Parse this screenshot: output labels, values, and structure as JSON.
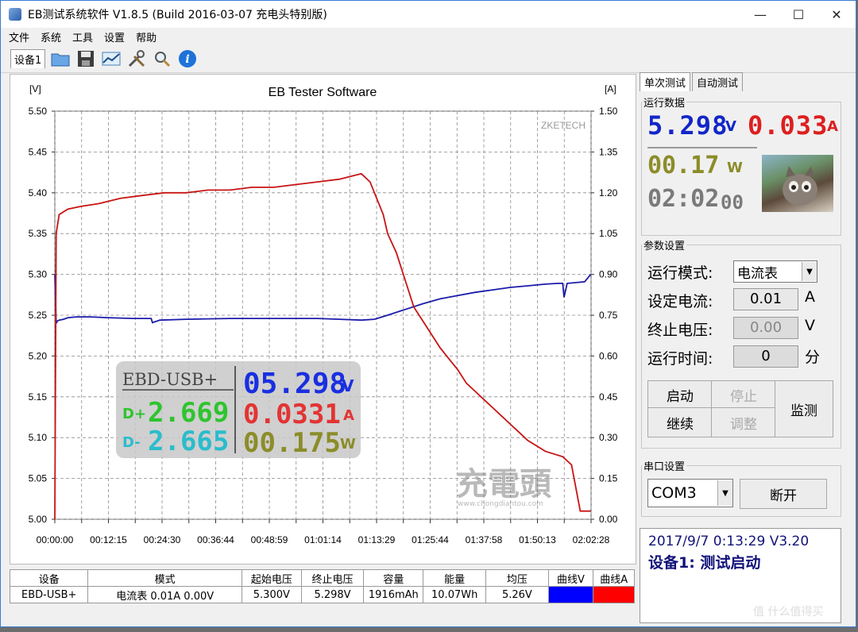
{
  "window": {
    "title": "EB测试系统软件 V1.8.5 (Build 2016-03-07 充电头特别版)",
    "controls": [
      "—",
      "☐",
      "✕"
    ]
  },
  "menu": [
    "文件",
    "系统",
    "工具",
    "设置",
    "帮助"
  ],
  "toolbar": {
    "device_tab": "设备1",
    "icons": [
      "folder-icon",
      "save-icon",
      "chart-icon",
      "tools-icon",
      "search-icon",
      "info-icon"
    ]
  },
  "chart_data": {
    "type": "line",
    "title": "EB Tester Software",
    "watermark_text": "ZKETECH",
    "y_left_unit": "[V]",
    "y_right_unit": "[A]",
    "y_left_ticks": [
      "5.50",
      "5.45",
      "5.40",
      "5.35",
      "5.30",
      "5.25",
      "5.20",
      "5.15",
      "5.10",
      "5.05",
      "5.00"
    ],
    "y_right_ticks": [
      "1.50",
      "1.35",
      "1.20",
      "1.05",
      "0.90",
      "0.75",
      "0.60",
      "0.45",
      "0.30",
      "0.15",
      "0.00"
    ],
    "x_ticks": [
      "00:00:00",
      "00:12:15",
      "00:24:30",
      "00:36:44",
      "00:48:59",
      "01:01:14",
      "01:13:29",
      "01:25:44",
      "01:37:58",
      "01:50:13",
      "02:02:28"
    ],
    "ylim_left": [
      5.0,
      5.5
    ],
    "ylim_right": [
      0.0,
      1.5
    ],
    "x_range_minutes": [
      0,
      122.47
    ],
    "grid": true,
    "series": [
      {
        "color": "#1b1baa",
        "axis": "left",
        "x_minutes": [
          0,
          0.3,
          0.6,
          1,
          2,
          3,
          5,
          8,
          12,
          18,
          22,
          22.3,
          24,
          30,
          40,
          50,
          60,
          65,
          70,
          73,
          76,
          80,
          84,
          88,
          92,
          96,
          100,
          104,
          108,
          112,
          115,
          116,
          116.3,
          117,
          121,
          122.4
        ],
        "y": [
          5.3,
          5.24,
          5.243,
          5.244,
          5.245,
          5.247,
          5.248,
          5.248,
          5.247,
          5.246,
          5.246,
          5.241,
          5.244,
          5.245,
          5.246,
          5.246,
          5.246,
          5.245,
          5.244,
          5.245,
          5.25,
          5.257,
          5.264,
          5.27,
          5.274,
          5.278,
          5.281,
          5.284,
          5.286,
          5.288,
          5.289,
          5.289,
          5.272,
          5.289,
          5.291,
          5.3
        ]
      },
      {
        "color": "#c81414",
        "axis": "right",
        "x_minutes": [
          0,
          0.3,
          1,
          3,
          6,
          10,
          15,
          20,
          25,
          30,
          35,
          40,
          45,
          50,
          55,
          60,
          65,
          70,
          72,
          73,
          75,
          76,
          78,
          80,
          82,
          84,
          86,
          88,
          90,
          92,
          94,
          96,
          98,
          100,
          102,
          104,
          106,
          108,
          110,
          112,
          114,
          116,
          118,
          120,
          122.4
        ],
        "y": [
          0.0,
          1.05,
          1.12,
          1.14,
          1.15,
          1.16,
          1.18,
          1.19,
          1.2,
          1.2,
          1.21,
          1.21,
          1.22,
          1.22,
          1.23,
          1.24,
          1.25,
          1.27,
          1.24,
          1.2,
          1.12,
          1.05,
          0.98,
          0.88,
          0.78,
          0.73,
          0.68,
          0.63,
          0.59,
          0.55,
          0.5,
          0.47,
          0.44,
          0.41,
          0.38,
          0.35,
          0.32,
          0.29,
          0.27,
          0.25,
          0.24,
          0.23,
          0.2,
          0.03,
          0.03
        ]
      }
    ]
  },
  "overlay": {
    "device": "EBD-USB+",
    "voltage": "05.298",
    "voltage_unit": "V",
    "dplus_label": "D+",
    "dplus_value": "2.669",
    "current": "0.0331",
    "current_unit": "A",
    "dminus_label": "D-",
    "dminus_value": "2.665",
    "power": "00.175",
    "power_unit": "W",
    "brand_watermark": "充電頭",
    "brand_url": "www.chongdiantou.com"
  },
  "right_panel": {
    "tabs": [
      "单次测试",
      "自动测试"
    ],
    "run_data": {
      "legend": "运行数据",
      "voltage": "5.298",
      "voltage_unit": "V",
      "current": "0.033",
      "current_unit": "A",
      "power": "00.17",
      "power_unit": "W",
      "time": "02:02",
      "time_seconds": "00"
    },
    "params": {
      "legend": "参数设置",
      "mode_label": "运行模式:",
      "mode_value": "电流表",
      "current_label": "设定电流:",
      "current_value": "0.01",
      "current_unit": "A",
      "stop_voltage_label": "终止电压:",
      "stop_voltage_value": "0.00",
      "stop_voltage_unit": "V",
      "run_time_label": "运行时间:",
      "run_time_value": "0",
      "run_time_unit": "分"
    },
    "buttons": {
      "start": "启动",
      "stop": "停止",
      "continue": "继续",
      "adjust": "调整",
      "monitor": "监测"
    },
    "serial": {
      "legend": "串口设置",
      "port": "COM3",
      "disconnect": "断开"
    },
    "status": {
      "line1": "2017/9/7 0:13:29  V3.20",
      "line2": "设备1: 测试启动"
    }
  },
  "table": {
    "headers": [
      "设备",
      "模式",
      "起始电压",
      "终止电压",
      "容量",
      "能量",
      "均压",
      "曲线V",
      "曲线A"
    ],
    "row": [
      "EBD-USB+",
      "电流表  0.01A  0.00V",
      "5.300V",
      "5.298V",
      "1916mAh",
      "10.07Wh",
      "5.26V",
      "",
      ""
    ],
    "curve_v_color": "#0000ff",
    "curve_a_color": "#ff0000"
  },
  "footer_watermark": "值 什么值得买"
}
